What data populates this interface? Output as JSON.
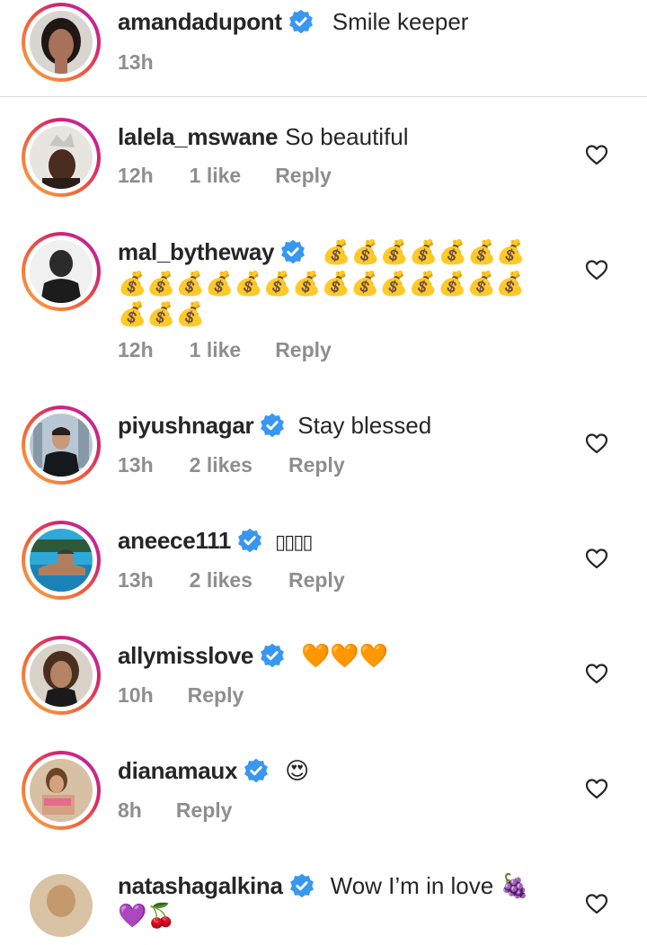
{
  "caption": {
    "username": "amandadupont",
    "verified": true,
    "text": "Smile keeper",
    "time": "13h"
  },
  "comments": [
    {
      "username": "lalela_mswane",
      "verified": false,
      "text": "So beautiful",
      "time": "12h",
      "likes": "1 like",
      "reply": "Reply"
    },
    {
      "username": "mal_bytheway",
      "verified": true,
      "text": "💰💰💰💰💰💰💰",
      "text_line2": "💰💰💰💰💰💰💰💰💰💰💰💰💰💰",
      "text_line3": "💰💰💰",
      "time": "12h",
      "likes": "1 like",
      "reply": "Reply"
    },
    {
      "username": "piyushnagar",
      "verified": true,
      "text": "Stay blessed",
      "time": "13h",
      "likes": "2 likes",
      "reply": "Reply"
    },
    {
      "username": "aneece111",
      "verified": true,
      "text": "▯▯▯▯",
      "time": "13h",
      "likes": "2 likes",
      "reply": "Reply"
    },
    {
      "username": "allymisslove",
      "verified": true,
      "text": "🧡🧡🧡",
      "time": "10h",
      "reply": "Reply"
    },
    {
      "username": "dianamaux",
      "verified": true,
      "text": "😍",
      "time": "8h",
      "reply": "Reply"
    },
    {
      "username": "natashagalkina",
      "verified": true,
      "text": "Wow I’m in love 🍇",
      "text_line2": "💜🍒"
    }
  ],
  "icons": {
    "verified": "verified-badge-icon",
    "like": "heart-outline-icon"
  },
  "colors": {
    "verified_blue": "#3897f0",
    "meta_gray": "#8e8e8e",
    "text": "#262626"
  }
}
